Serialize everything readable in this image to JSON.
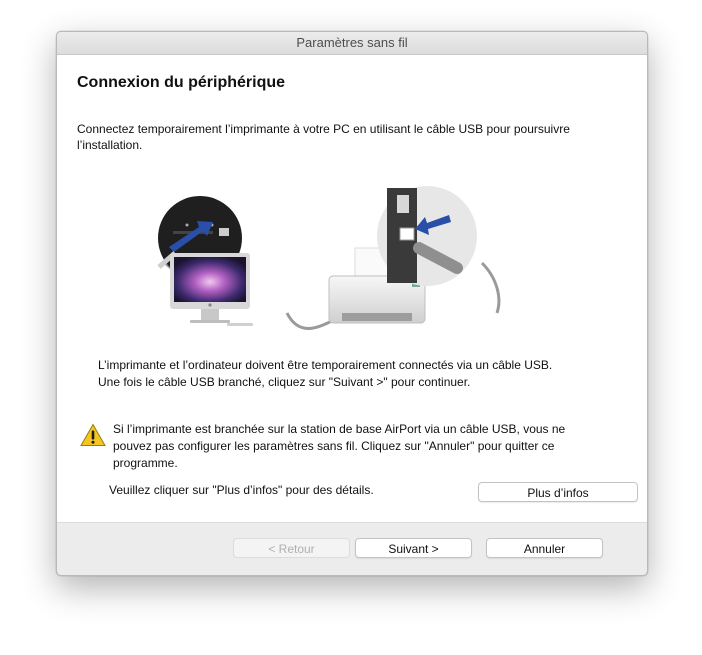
{
  "window": {
    "title": "Paramètres sans fil"
  },
  "page": {
    "heading": "Connexion du périphérique",
    "intro": "Connectez temporairement l’imprimante à votre PC en utilisant le câble USB pour poursuivre l’installation.",
    "instructions": [
      "L’imprimante et l’ordinateur doivent être temporairement connectés via un câble USB.",
      "Une fois le câble USB branché, cliquez sur \"Suivant >\" pour continuer."
    ],
    "warning": "Si l’imprimante est branchée sur la station de base AirPort via un câble USB, vous ne pouvez pas configurer les paramètres sans fil. Cliquez sur \"Annuler\" pour quitter ce programme.",
    "details_text": "Veuillez cliquer sur \"Plus d’infos\" pour des détails.",
    "more_info_label": "Plus d’infos"
  },
  "footer": {
    "back_label": "< Retour",
    "next_label": "Suivant >",
    "cancel_label": "Annuler"
  },
  "icons": {
    "warning": "warning-triangle-icon",
    "computer": "imac-computer-icon",
    "printer": "printer-icon",
    "usb": "usb-cable-icon"
  },
  "colors": {
    "arrow": "#2a4fa8",
    "warning": "#f3c623"
  }
}
